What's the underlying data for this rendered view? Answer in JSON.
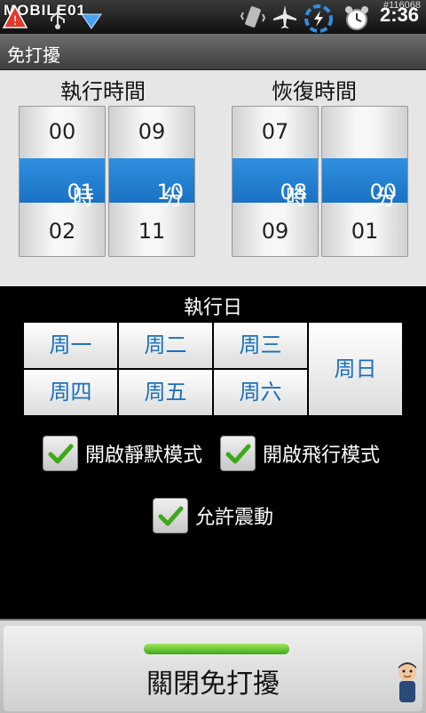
{
  "status_bar": {
    "watermark": "MOBILE01",
    "code": "#116068",
    "time": "2:36",
    "icons": [
      "warning-icon",
      "usb-icon",
      "download-icon",
      "vibrate-icon",
      "airplane-icon",
      "sync-icon",
      "alarm-icon"
    ]
  },
  "app": {
    "title": "免打擾"
  },
  "pickers": {
    "exec": {
      "label": "執行時間",
      "hours": {
        "prev": "00",
        "selected": "01",
        "next": "02",
        "unit": "時"
      },
      "minutes": {
        "prev": "09",
        "selected": "10",
        "next": "11",
        "unit": "分"
      }
    },
    "restore": {
      "label": "恢復時間",
      "hours": {
        "prev": "07",
        "selected": "08",
        "next": "09",
        "unit": "時"
      },
      "minutes": {
        "prev": "",
        "selected": "00",
        "next": "01",
        "unit": "分"
      }
    }
  },
  "days": {
    "label": "執行日",
    "mon": "周一",
    "tue": "周二",
    "wed": "周三",
    "sun": "周日",
    "thu": "周四",
    "fri": "周五",
    "sat": "周六"
  },
  "options": {
    "silent": {
      "label": "開啟靜默模式",
      "checked": true
    },
    "airplane": {
      "label": "開啟飛行模式",
      "checked": true
    },
    "vibrate": {
      "label": "允許震動",
      "checked": true
    }
  },
  "action": {
    "label": "關閉免打擾",
    "indicator_color": "#4cbb17"
  },
  "colors": {
    "accent": "#1a72c4",
    "day_text": "#1a6fbd"
  }
}
